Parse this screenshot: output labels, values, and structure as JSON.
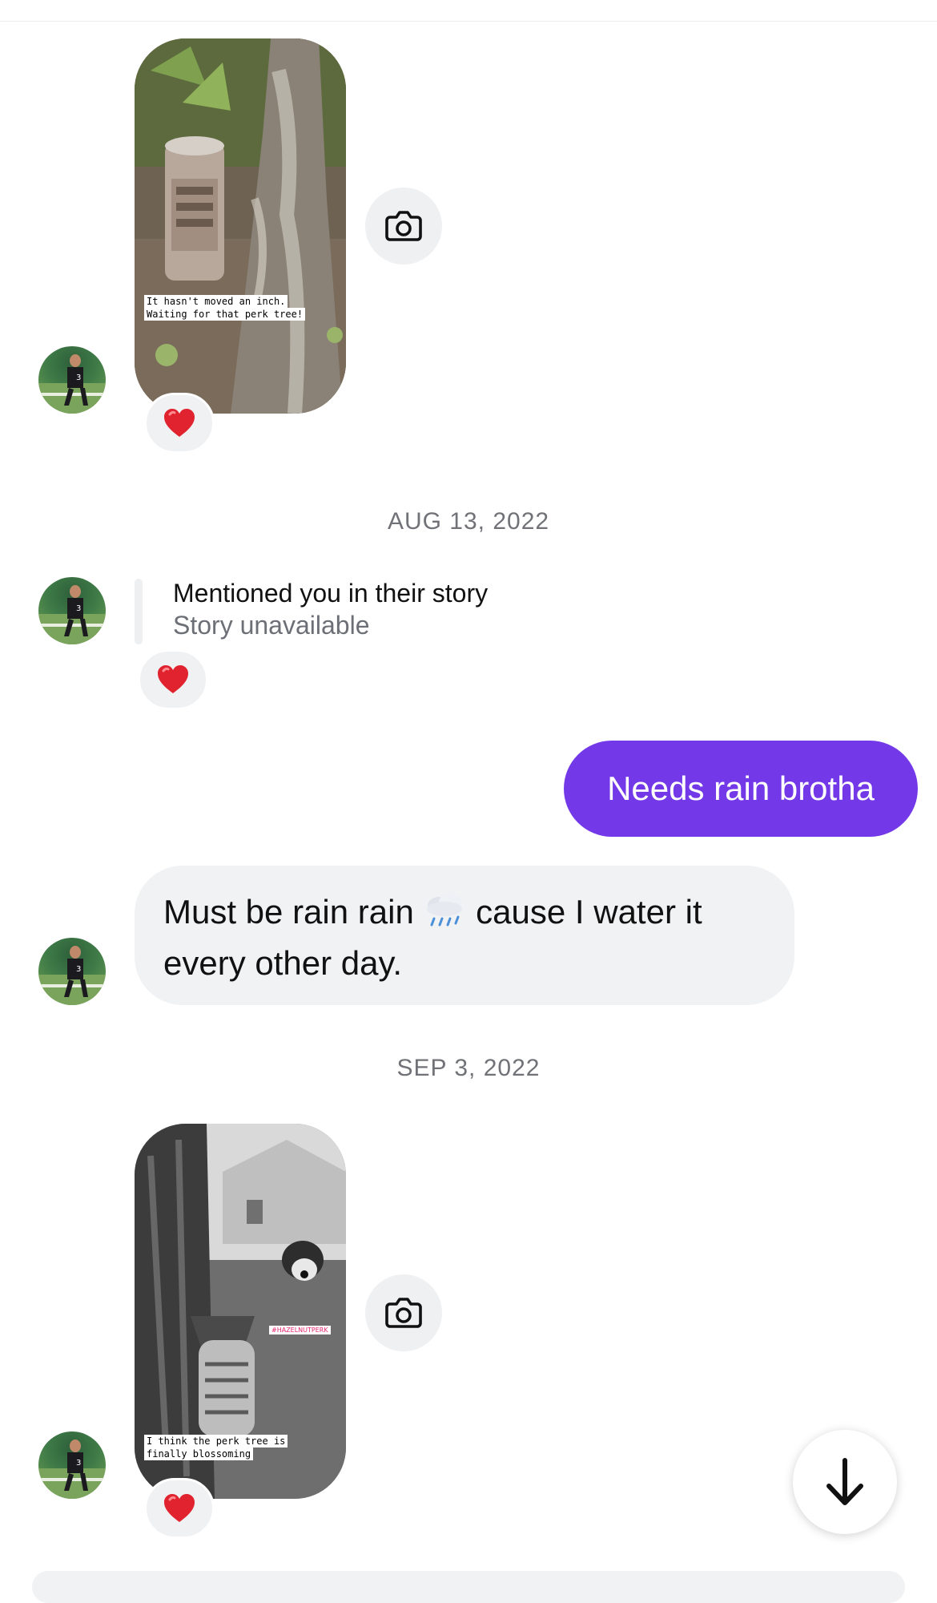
{
  "messages": {
    "story1": {
      "caption_line1": "It hasn't moved an inch.",
      "caption_line2": "Waiting for that perk tree!",
      "reaction": "❤️"
    },
    "date1": "AUG 13, 2022",
    "mention": {
      "title": "Mentioned you in their story",
      "subtitle": "Story unavailable",
      "reaction": "❤️"
    },
    "outgoing": {
      "text": "Needs rain brotha"
    },
    "incoming": {
      "text_before_emoji": "Must be rain rain ",
      "emoji": "🌧️",
      "text_after_emoji": " cause I water it every other day."
    },
    "date2": "SEP 3, 2022",
    "story2": {
      "tag": "#HAZELNUTPERK",
      "caption_line1": "I think the perk tree is",
      "caption_line2": "finally blossoming",
      "reaction": "❤️"
    }
  },
  "icons": {
    "camera": "camera-icon",
    "heart": "heart-icon",
    "arrow_down": "arrow-down-icon"
  },
  "colors": {
    "accent": "#7339e8",
    "incoming_bubble": "#f1f2f4",
    "date_text": "#707277"
  }
}
